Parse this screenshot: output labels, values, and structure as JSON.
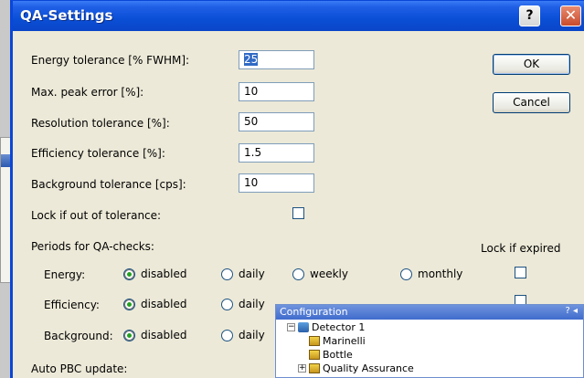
{
  "dialog": {
    "title": "QA-Settings",
    "help_label": "?",
    "close_label": "✕"
  },
  "fields": [
    {
      "label": "Energy tolerance [% FWHM]:",
      "value": "25"
    },
    {
      "label": "Max. peak error [%]:",
      "value": "10"
    },
    {
      "label": "Resolution tolerance [%]:",
      "value": "50"
    },
    {
      "label": "Efficiency tolerance [%]:",
      "value": "1.5"
    },
    {
      "label": "Background tolerance [cps]:",
      "value": "10"
    }
  ],
  "buttons": {
    "ok": "OK",
    "cancel": "Cancel"
  },
  "lock_out_of_tolerance": {
    "label": "Lock if out of tolerance:",
    "checked": false
  },
  "periods": {
    "heading": "Periods for QA-checks:",
    "lock_expired_label": "Lock if expired",
    "options": [
      "disabled",
      "daily",
      "weekly",
      "monthly"
    ],
    "rows": [
      {
        "label": "Energy:",
        "selected": "disabled"
      },
      {
        "label": "Efficiency:",
        "selected": "disabled"
      },
      {
        "label": "Background:",
        "selected": "disabled"
      }
    ]
  },
  "auto_pbc_label": "Auto PBC update:",
  "configuration_window": {
    "title": "Configuration",
    "controls": "?  ◂",
    "tree": [
      {
        "label": "Detector 1",
        "icon": "detector-icon"
      },
      {
        "label": "Marinelli",
        "icon": "sample-icon"
      },
      {
        "label": "Bottle",
        "icon": "sample-icon"
      },
      {
        "label": "Quality Assurance",
        "icon": "sample-icon"
      }
    ]
  }
}
